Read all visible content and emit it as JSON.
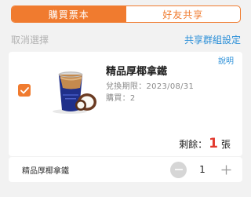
{
  "tabs": [
    {
      "label": "購買票本",
      "active": true
    },
    {
      "label": "好友共享",
      "active": false
    }
  ],
  "subheader": {
    "deselect_label": "取消選擇",
    "group_setting_label": "共享群組設定"
  },
  "card": {
    "explain_label": "說明",
    "checked": true,
    "product_name": "精品厚椰拿鐵",
    "expiry": "兌換期限：2023/08/31",
    "purchased": "購買：2",
    "remaining_label": "剩餘：",
    "remaining_count": "1",
    "remaining_unit": "張",
    "image_icon": "coconut-latte-cup-image"
  },
  "bottom": {
    "product_name": "精品厚椰拿鐵",
    "quantity": "1",
    "minus_icon": "minus-icon",
    "plus_icon": "plus-icon"
  },
  "colors": {
    "accent": "#f07b2f",
    "link": "#2a8fd8",
    "highlight": "#e23a2f"
  }
}
